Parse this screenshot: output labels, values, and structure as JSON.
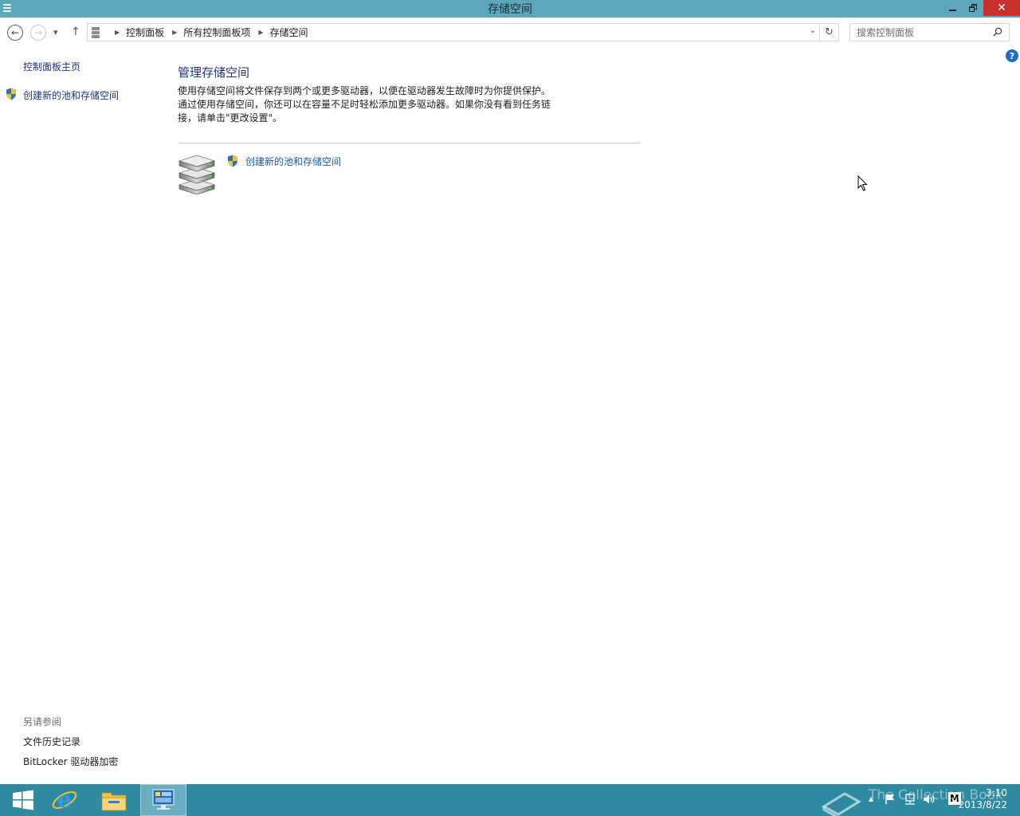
{
  "window": {
    "title": "存储空间",
    "minimize_icon": "minimize-icon",
    "restore_icon": "restore-icon",
    "close_label": "✕"
  },
  "navbar": {
    "back_label": "←",
    "forward_label": "→",
    "recent_label": "▾",
    "up_label": "↑",
    "breadcrumbs": [
      "控制面板",
      "所有控制面板项",
      "存储空间"
    ],
    "refresh_label": "↻",
    "search_placeholder": "搜索控制面板"
  },
  "sidebar": {
    "home_link": "控制面板主页",
    "create_link": "创建新的池和存储空间",
    "see_also_title": "另请参阅",
    "see_also_links": [
      "文件历史记录",
      "BitLocker 驱动器加密"
    ]
  },
  "main": {
    "help_label": "?",
    "title": "管理存储空间",
    "description_lines": [
      "使用存储空间将文件保存到两个或更多驱动器，以便在驱动器发生故障时为你提供保护。",
      "通过使用存储空间，你还可以在容量不足时轻松添加更多驱动器。如果你没有看到任务链",
      "接，请单击\"更改设置\"。"
    ],
    "task_link": "创建新的池和存储空间"
  },
  "taskbar": {
    "watermark": "The Collection Book",
    "time": "3:10",
    "date": "2013/8/22",
    "ime_label": "M",
    "tray_expand_label": "▲"
  }
}
